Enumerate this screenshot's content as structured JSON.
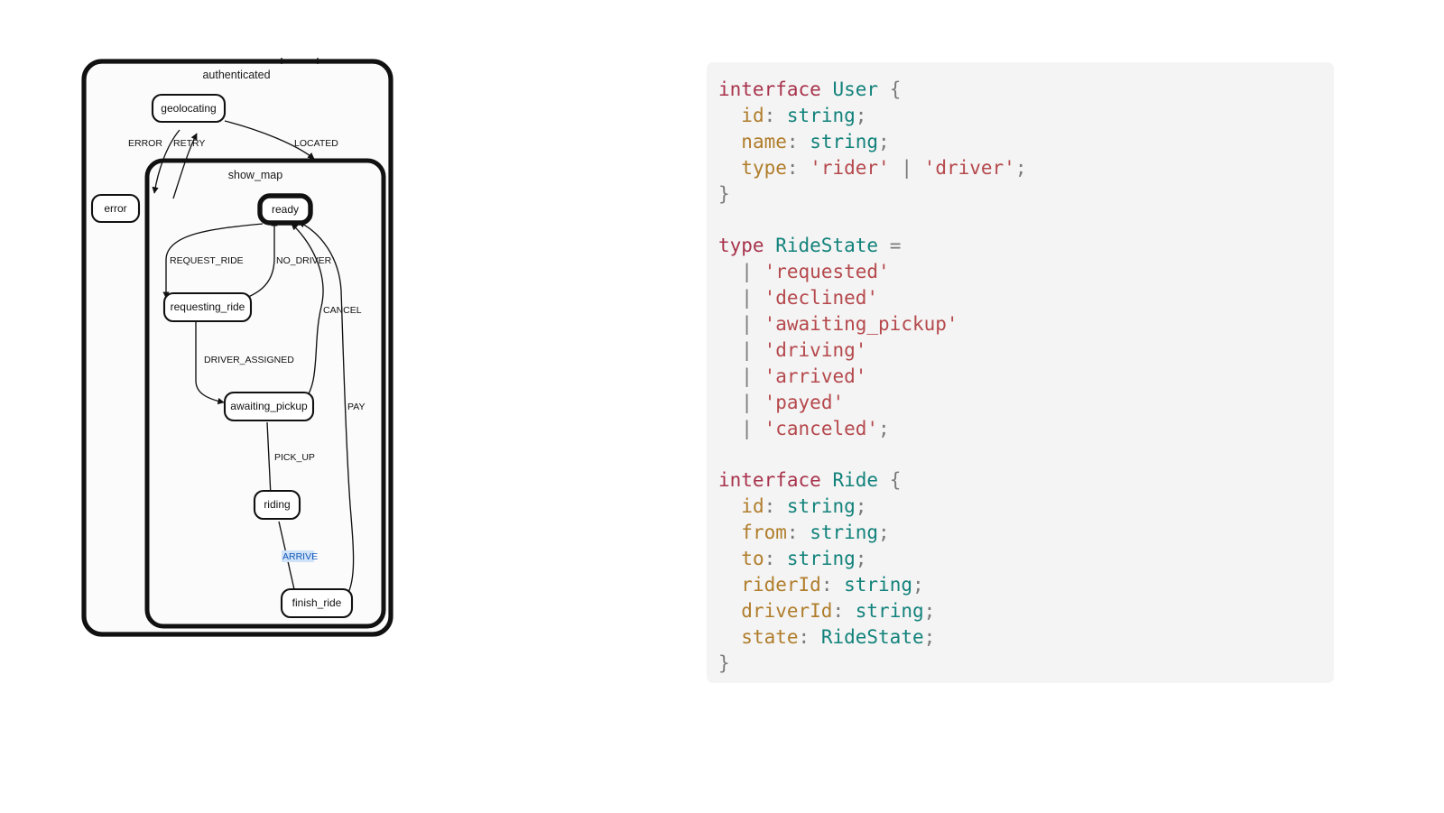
{
  "statechart": {
    "groups": [
      {
        "id": "authenticated",
        "title": "authenticated"
      },
      {
        "id": "show_map",
        "title": "show_map"
      }
    ],
    "nodes": [
      {
        "id": "geolocating",
        "label": "geolocating",
        "active": false
      },
      {
        "id": "error",
        "label": "error",
        "active": false
      },
      {
        "id": "ready",
        "label": "ready",
        "active": true
      },
      {
        "id": "requesting_ride",
        "label": "requesting_ride",
        "active": false
      },
      {
        "id": "awaiting_pickup",
        "label": "awaiting_pickup",
        "active": false
      },
      {
        "id": "riding",
        "label": "riding",
        "active": false
      },
      {
        "id": "finish_ride",
        "label": "finish_ride",
        "active": false
      }
    ],
    "edges": [
      {
        "id": "error-edge",
        "label": "ERROR",
        "from": "geolocating",
        "to": "error",
        "selected": false
      },
      {
        "id": "retry-edge",
        "label": "RETRY",
        "from": "error",
        "to": "geolocating",
        "selected": false
      },
      {
        "id": "located-edge",
        "label": "LOCATED",
        "from": "geolocating",
        "to": "show_map",
        "selected": false
      },
      {
        "id": "request-ride-edge",
        "label": "REQUEST_RIDE",
        "from": "ready",
        "to": "requesting_ride",
        "selected": false
      },
      {
        "id": "no-driver-edge",
        "label": "NO_DRIVER",
        "from": "requesting_ride",
        "to": "ready",
        "selected": false
      },
      {
        "id": "driver-assigned-edge",
        "label": "DRIVER_ASSIGNED",
        "from": "requesting_ride",
        "to": "awaiting_pickup",
        "selected": false
      },
      {
        "id": "cancel-edge",
        "label": "CANCEL",
        "from": "awaiting_pickup",
        "to": "ready",
        "selected": false
      },
      {
        "id": "pick-up-edge",
        "label": "PICK_UP",
        "from": "awaiting_pickup",
        "to": "riding",
        "selected": false
      },
      {
        "id": "arrive-edge",
        "label": "ARRIVE",
        "from": "riding",
        "to": "finish_ride",
        "selected": true
      },
      {
        "id": "pay-edge",
        "label": "PAY",
        "from": "finish_ride",
        "to": "ready",
        "selected": false
      }
    ],
    "colors": {
      "stroke": "#111111",
      "node_fill": "#ffffff",
      "group_fill": "#fbfbfb",
      "selected_label_text": "#1459b8",
      "selected_label_bg": "#cfe2f8"
    }
  },
  "code_panel": {
    "background": "#f4f4f4",
    "language": "typescript",
    "lines": [
      [
        {
          "t": "kw",
          "v": "interface"
        },
        {
          "t": "plain",
          "v": " "
        },
        {
          "t": "type",
          "v": "User"
        },
        {
          "t": "plain",
          "v": " "
        },
        {
          "t": "punc",
          "v": "{"
        }
      ],
      [
        {
          "t": "plain",
          "v": "  "
        },
        {
          "t": "prop",
          "v": "id"
        },
        {
          "t": "punc",
          "v": ":"
        },
        {
          "t": "plain",
          "v": " "
        },
        {
          "t": "type",
          "v": "string"
        },
        {
          "t": "punc",
          "v": ";"
        }
      ],
      [
        {
          "t": "plain",
          "v": "  "
        },
        {
          "t": "prop",
          "v": "name"
        },
        {
          "t": "punc",
          "v": ":"
        },
        {
          "t": "plain",
          "v": " "
        },
        {
          "t": "type",
          "v": "string"
        },
        {
          "t": "punc",
          "v": ";"
        }
      ],
      [
        {
          "t": "plain",
          "v": "  "
        },
        {
          "t": "prop",
          "v": "type"
        },
        {
          "t": "punc",
          "v": ":"
        },
        {
          "t": "plain",
          "v": " "
        },
        {
          "t": "str",
          "v": "'rider'"
        },
        {
          "t": "plain",
          "v": " "
        },
        {
          "t": "op",
          "v": "|"
        },
        {
          "t": "plain",
          "v": " "
        },
        {
          "t": "str",
          "v": "'driver'"
        },
        {
          "t": "punc",
          "v": ";"
        }
      ],
      [
        {
          "t": "punc",
          "v": "}"
        }
      ],
      [
        {
          "t": "plain",
          "v": ""
        }
      ],
      [
        {
          "t": "kw",
          "v": "type"
        },
        {
          "t": "plain",
          "v": " "
        },
        {
          "t": "type",
          "v": "RideState"
        },
        {
          "t": "plain",
          "v": " "
        },
        {
          "t": "op",
          "v": "="
        }
      ],
      [
        {
          "t": "plain",
          "v": "  "
        },
        {
          "t": "op",
          "v": "|"
        },
        {
          "t": "plain",
          "v": " "
        },
        {
          "t": "str",
          "v": "'requested'"
        }
      ],
      [
        {
          "t": "plain",
          "v": "  "
        },
        {
          "t": "op",
          "v": "|"
        },
        {
          "t": "plain",
          "v": " "
        },
        {
          "t": "str",
          "v": "'declined'"
        }
      ],
      [
        {
          "t": "plain",
          "v": "  "
        },
        {
          "t": "op",
          "v": "|"
        },
        {
          "t": "plain",
          "v": " "
        },
        {
          "t": "str",
          "v": "'awaiting_pickup'"
        }
      ],
      [
        {
          "t": "plain",
          "v": "  "
        },
        {
          "t": "op",
          "v": "|"
        },
        {
          "t": "plain",
          "v": " "
        },
        {
          "t": "str",
          "v": "'driving'"
        }
      ],
      [
        {
          "t": "plain",
          "v": "  "
        },
        {
          "t": "op",
          "v": "|"
        },
        {
          "t": "plain",
          "v": " "
        },
        {
          "t": "str",
          "v": "'arrived'"
        }
      ],
      [
        {
          "t": "plain",
          "v": "  "
        },
        {
          "t": "op",
          "v": "|"
        },
        {
          "t": "plain",
          "v": " "
        },
        {
          "t": "str",
          "v": "'payed'"
        }
      ],
      [
        {
          "t": "plain",
          "v": "  "
        },
        {
          "t": "op",
          "v": "|"
        },
        {
          "t": "plain",
          "v": " "
        },
        {
          "t": "str",
          "v": "'canceled'"
        },
        {
          "t": "punc",
          "v": ";"
        }
      ],
      [
        {
          "t": "plain",
          "v": ""
        }
      ],
      [
        {
          "t": "kw",
          "v": "interface"
        },
        {
          "t": "plain",
          "v": " "
        },
        {
          "t": "type",
          "v": "Ride"
        },
        {
          "t": "plain",
          "v": " "
        },
        {
          "t": "punc",
          "v": "{"
        }
      ],
      [
        {
          "t": "plain",
          "v": "  "
        },
        {
          "t": "prop",
          "v": "id"
        },
        {
          "t": "punc",
          "v": ":"
        },
        {
          "t": "plain",
          "v": " "
        },
        {
          "t": "type",
          "v": "string"
        },
        {
          "t": "punc",
          "v": ";"
        }
      ],
      [
        {
          "t": "plain",
          "v": "  "
        },
        {
          "t": "prop",
          "v": "from"
        },
        {
          "t": "punc",
          "v": ":"
        },
        {
          "t": "plain",
          "v": " "
        },
        {
          "t": "type",
          "v": "string"
        },
        {
          "t": "punc",
          "v": ";"
        }
      ],
      [
        {
          "t": "plain",
          "v": "  "
        },
        {
          "t": "prop",
          "v": "to"
        },
        {
          "t": "punc",
          "v": ":"
        },
        {
          "t": "plain",
          "v": " "
        },
        {
          "t": "type",
          "v": "string"
        },
        {
          "t": "punc",
          "v": ";"
        }
      ],
      [
        {
          "t": "plain",
          "v": "  "
        },
        {
          "t": "prop",
          "v": "riderId"
        },
        {
          "t": "punc",
          "v": ":"
        },
        {
          "t": "plain",
          "v": " "
        },
        {
          "t": "type",
          "v": "string"
        },
        {
          "t": "punc",
          "v": ";"
        }
      ],
      [
        {
          "t": "plain",
          "v": "  "
        },
        {
          "t": "prop",
          "v": "driverId"
        },
        {
          "t": "punc",
          "v": ":"
        },
        {
          "t": "plain",
          "v": " "
        },
        {
          "t": "type",
          "v": "string"
        },
        {
          "t": "punc",
          "v": ";"
        }
      ],
      [
        {
          "t": "plain",
          "v": "  "
        },
        {
          "t": "prop",
          "v": "state"
        },
        {
          "t": "punc",
          "v": ":"
        },
        {
          "t": "plain",
          "v": " "
        },
        {
          "t": "type",
          "v": "RideState"
        },
        {
          "t": "punc",
          "v": ";"
        }
      ],
      [
        {
          "t": "punc",
          "v": "}"
        }
      ]
    ]
  }
}
